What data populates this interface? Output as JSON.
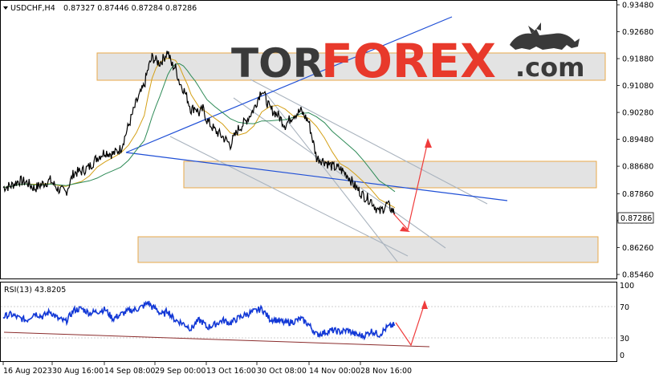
{
  "header": {
    "instrument": "USDCHF,H4",
    "ohlc": "0.87327 0.87446 0.87284 0.87286"
  },
  "logo": {
    "part1": "TOR",
    "part2": "FOREX",
    "part3": ".com"
  },
  "rsi": {
    "label": "RSI(13) 43.8205",
    "levels": [
      "100",
      "70",
      "30",
      "0"
    ]
  },
  "colors": {
    "price": "#000000",
    "ma_fast": "#d4a017",
    "ma_slow": "#2e8b57",
    "trend": "#1f4fd6",
    "channel": "#a9b3be",
    "zone_fill": "#e3e3e3",
    "zone_border": "#e8a94a",
    "arrow": "#ef3b3b",
    "rsi": "#1238d6",
    "rsi_trend": "#8b2c2c",
    "logo_dark": "#3a3a3a",
    "logo_red": "#e8392b"
  },
  "chart_data": {
    "type": "line",
    "title": "USDCHF,H4",
    "yticks": [
      "0.93480",
      "0.92680",
      "0.91880",
      "0.91080",
      "0.90280",
      "0.89480",
      "0.88680",
      "0.87860",
      "0.87060",
      "0.86260",
      "0.85460"
    ],
    "current_price_label": "0.87286",
    "xticks": [
      "16 Aug 2023",
      "30 Aug 16:00",
      "14 Sep 08:00",
      "29 Sep 00:00",
      "13 Oct 16:00",
      "30 Oct 08:00",
      "14 Nov 00:00",
      "28 Nov 16:00"
    ],
    "ylim": [
      0.8546,
      0.9348
    ],
    "grid": false,
    "series": [
      {
        "x": [
          0,
          10,
          20,
          30,
          40,
          50,
          60,
          70,
          80,
          90,
          100,
          110,
          120,
          130,
          140,
          150,
          160,
          170,
          180,
          185,
          190,
          195,
          200,
          205,
          210,
          215,
          220,
          225,
          230,
          235,
          240,
          245,
          250,
          255,
          260,
          270,
          280,
          290,
          300,
          310,
          320,
          330,
          340,
          350,
          360,
          370,
          380,
          390,
          400,
          410,
          420,
          430,
          440,
          450,
          460,
          470,
          480,
          490,
          500
        ],
        "values": [
          0.8805,
          0.881,
          0.8825,
          0.882,
          0.8802,
          0.8815,
          0.8826,
          0.88,
          0.879,
          0.8848,
          0.8853,
          0.8866,
          0.8894,
          0.8911,
          0.8904,
          0.892,
          0.8988,
          0.9058,
          0.9108,
          0.9158,
          0.9192,
          0.9182,
          0.9175,
          0.919,
          0.921,
          0.917,
          0.916,
          0.9118,
          0.9098,
          0.907,
          0.9035,
          0.9045,
          0.9025,
          0.9038,
          0.9005,
          0.8975,
          0.8956,
          0.8932,
          0.8978,
          0.9003,
          0.9038,
          0.9098,
          0.904,
          0.9022,
          0.899,
          0.902,
          0.9032,
          0.9,
          0.8893,
          0.8883,
          0.8867,
          0.886,
          0.884,
          0.8805,
          0.878,
          0.8765,
          0.873,
          0.8755,
          0.8728
        ]
      }
    ],
    "rsi_series": {
      "x": [
        0,
        10,
        20,
        30,
        40,
        50,
        60,
        70,
        80,
        90,
        100,
        110,
        120,
        130,
        140,
        150,
        160,
        170,
        180,
        185,
        190,
        195,
        200,
        205,
        210,
        215,
        220,
        225,
        230,
        235,
        240,
        245,
        250,
        255,
        260,
        270,
        280,
        290,
        300,
        310,
        320,
        330,
        340,
        350,
        360,
        370,
        380,
        390,
        400,
        410,
        420,
        430,
        440,
        450,
        460,
        470,
        480,
        490,
        500
      ],
      "values": [
        55,
        58,
        53,
        50,
        60,
        55,
        62,
        52,
        48,
        64,
        66,
        60,
        62,
        65,
        52,
        58,
        63,
        65,
        70,
        75,
        68,
        66,
        60,
        58,
        64,
        55,
        50,
        48,
        45,
        42,
        38,
        45,
        50,
        47,
        40,
        44,
        50,
        46,
        53,
        58,
        62,
        66,
        52,
        50,
        46,
        48,
        52,
        44,
        30,
        33,
        36,
        34,
        36,
        30,
        28,
        35,
        30,
        40,
        43.82
      ]
    }
  }
}
